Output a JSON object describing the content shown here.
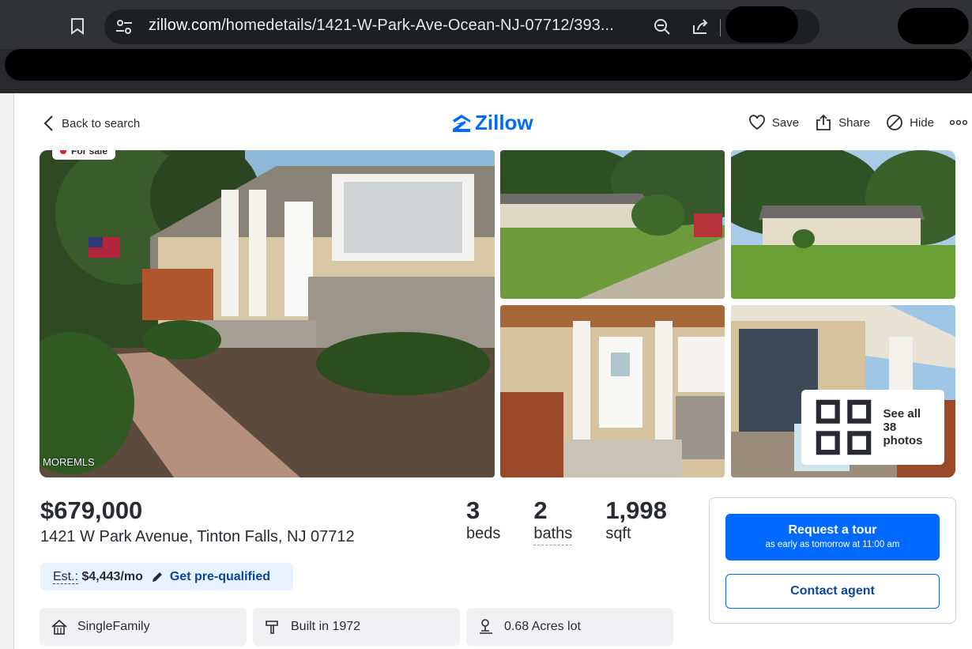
{
  "browser": {
    "url_host": "zillow.com",
    "url_path": "/homedetails/1421-W-Park-Ave-Ocean-NJ-07712/393..."
  },
  "header": {
    "back_label": "Back to search",
    "logo_text": "Zillow",
    "actions": {
      "save": "Save",
      "share": "Share",
      "hide": "Hide"
    }
  },
  "gallery": {
    "status_badge": "For sale",
    "mls_watermark": "MOREMLS",
    "see_all_label": "See all 38 photos"
  },
  "listing": {
    "price": "$679,000",
    "address": "1421 W Park Avenue, Tinton Falls, NJ 07712",
    "stats": [
      {
        "value": "3",
        "label": "beds"
      },
      {
        "value": "2",
        "label": "baths"
      },
      {
        "value": "1,998",
        "label": "sqft"
      }
    ],
    "estimate_label": "Est.:",
    "estimate_value": "$4,443/mo",
    "prequalify_label": "Get pre-qualified",
    "facts": [
      {
        "icon": "house-icon",
        "text": "SingleFamily"
      },
      {
        "icon": "hammer-icon",
        "text": "Built in 1972"
      },
      {
        "icon": "lot-icon",
        "text": "0.68 Acres lot"
      }
    ]
  },
  "cta": {
    "tour_label": "Request a tour",
    "tour_sublabel": "as early as tomorrow at 11:00 am",
    "contact_label": "Contact agent"
  },
  "colors": {
    "brand_blue": "#006aff",
    "dark_text": "#2a2a33",
    "link_blue": "#0d4599",
    "estimate_bg": "#e6f2ff"
  }
}
